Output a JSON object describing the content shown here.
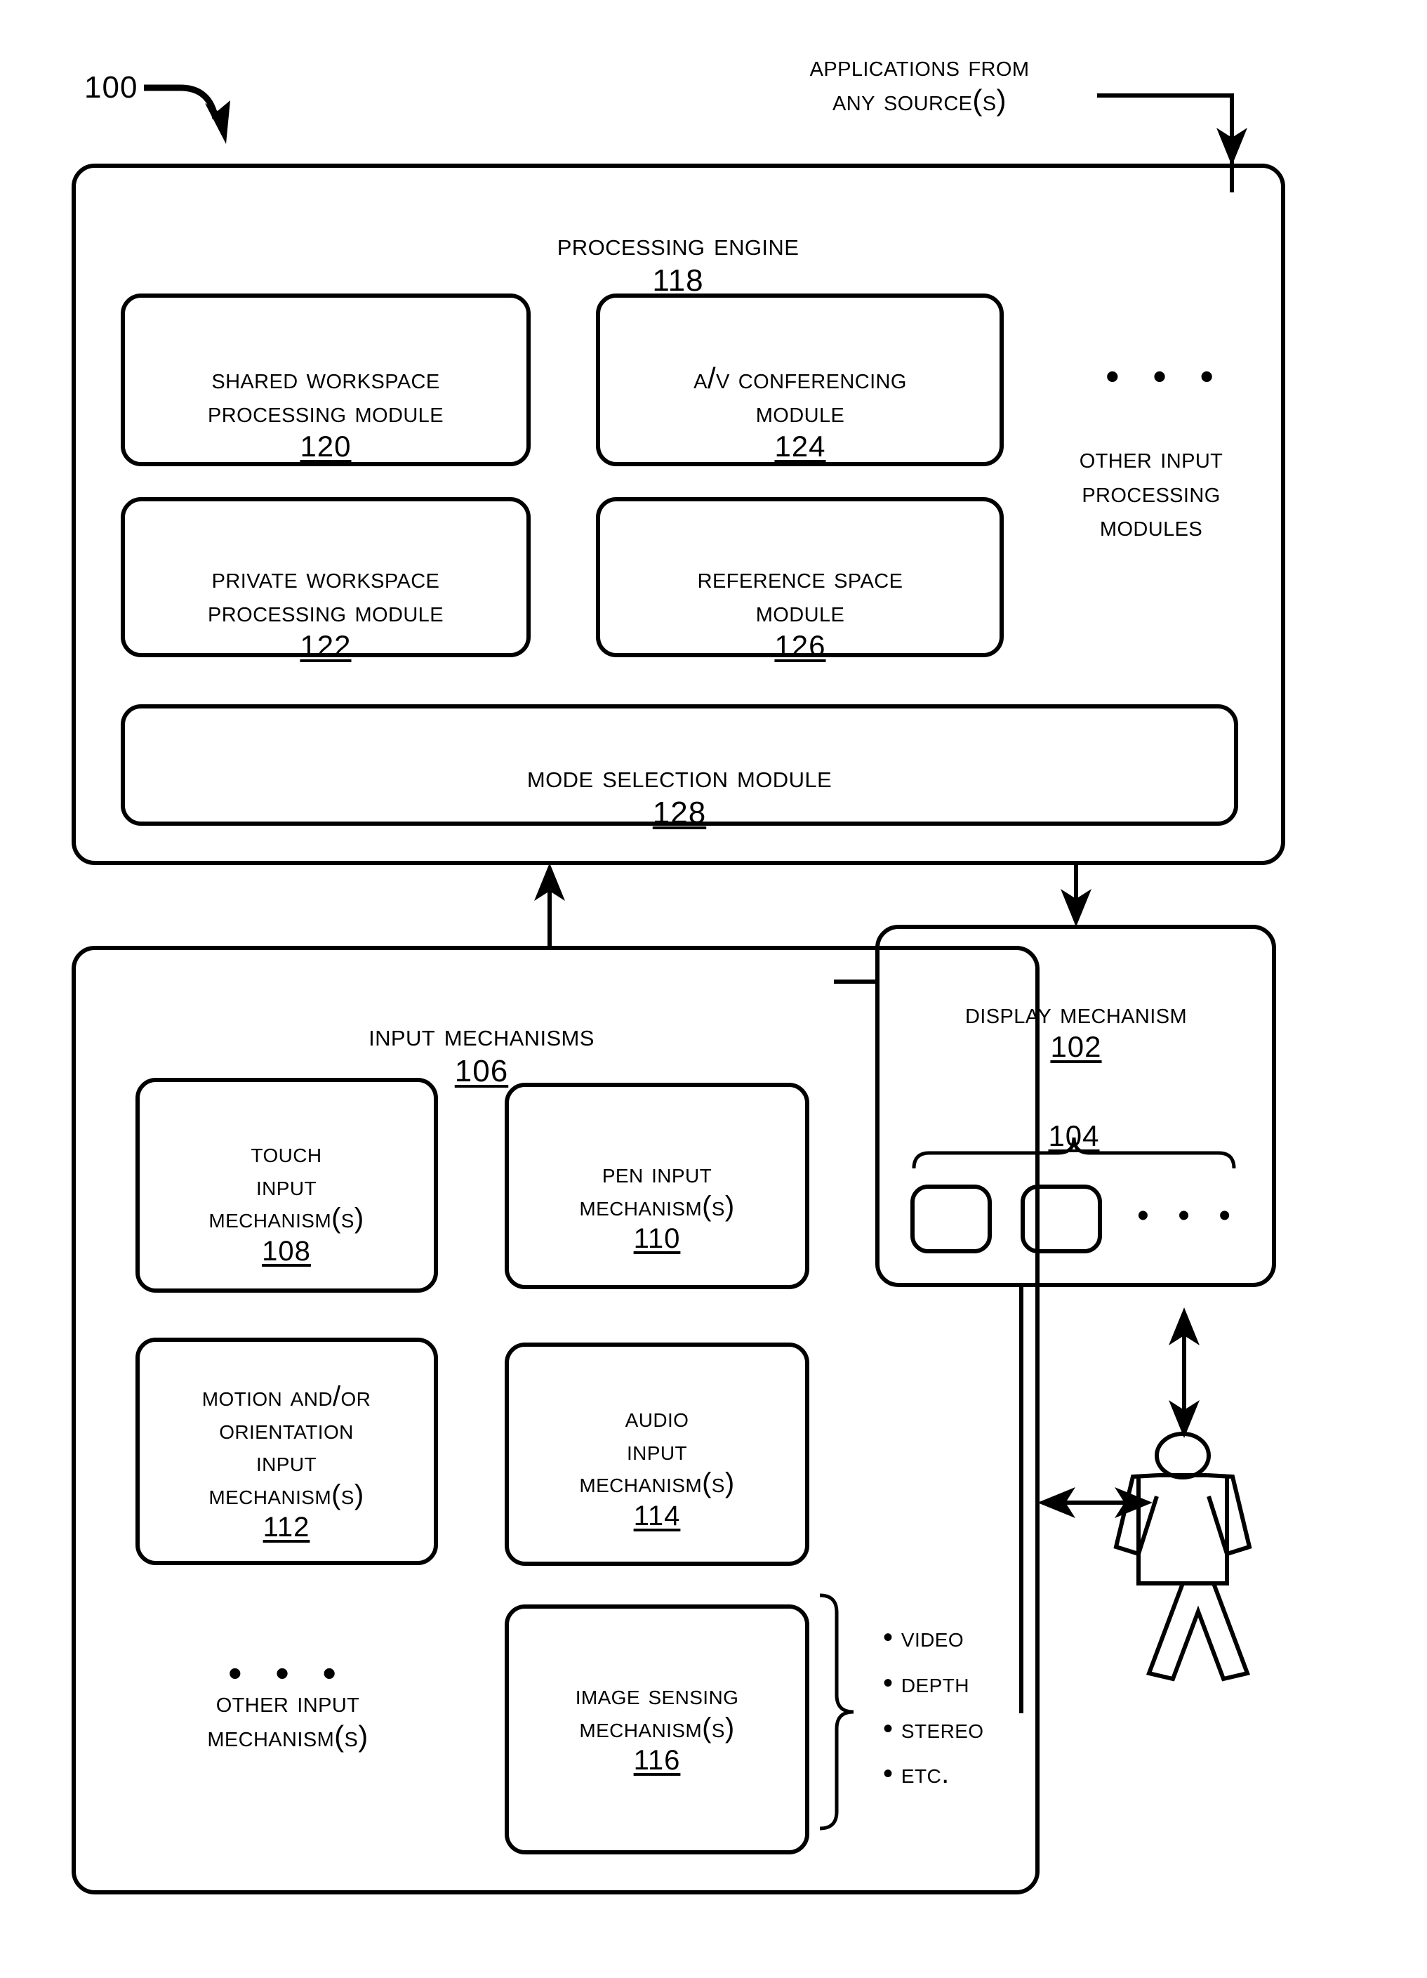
{
  "figure": {
    "number": "100"
  },
  "external_input": {
    "label": "Applications From\nAny Source(s)"
  },
  "processing_engine": {
    "title": "Processing Engine",
    "ref": "118",
    "modules": [
      {
        "title": "Shared Workspace\nProcessing Module",
        "ref": "120"
      },
      {
        "title": "A/V Conferencing\nModule",
        "ref": "124"
      },
      {
        "title": "Private Workspace\nProcessing Module",
        "ref": "122"
      },
      {
        "title": "Reference Space\nModule",
        "ref": "126"
      }
    ],
    "other_modules": {
      "ellipsis": "• • •",
      "label": "Other Input\nProcessing\nModules"
    },
    "mode_selection": {
      "title": "Mode Selection Module",
      "ref": "128"
    }
  },
  "display_mechanism": {
    "title": "Display Mechanism",
    "ref": "102",
    "surfaces_ref": "104",
    "surfaces_ellipsis": "• • •"
  },
  "input_mechanisms": {
    "title": "Input Mechanisms",
    "ref": "106",
    "items": [
      {
        "title": "Touch\nInput\nMechanism(s)",
        "ref": "108"
      },
      {
        "title": "Pen Input\nMechanism(s)",
        "ref": "110"
      },
      {
        "title": "Motion and/or\nOrientation\nInput\nMechanism(s)",
        "ref": "112"
      },
      {
        "title": "Audio\nInput\nMechanism(s)",
        "ref": "114"
      },
      {
        "title": "Image Sensing\nMechanism(s)",
        "ref": "116"
      }
    ],
    "other_items": {
      "ellipsis": "• • •",
      "label": "Other Input\nMechanism(s)"
    },
    "sensing_types": [
      "• Video",
      "• Depth",
      "• Stereo",
      "• Etc."
    ]
  },
  "user": {
    "label": "person-figure"
  }
}
